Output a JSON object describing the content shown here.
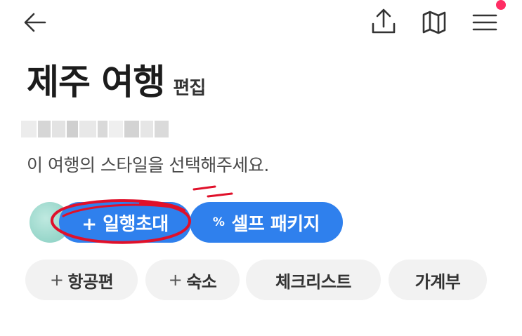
{
  "header": {
    "back_icon": "arrow-left-icon",
    "share_icon": "upload-share-icon",
    "map_icon": "map-icon",
    "menu_icon": "hamburger-menu-icon",
    "notification_dot_color": "#ff2d64"
  },
  "trip": {
    "title": "제주 여행",
    "edit_label": "편집",
    "subtitle": "이 여행의 스타일을 선택해주세요."
  },
  "actions": {
    "invite_label": "+ 일행초대",
    "self_pct": "%",
    "self_label": "셀프 패키지",
    "accent_color": "#2f80ed"
  },
  "chips": {
    "flight_plus": "+",
    "flight_label": "항공편",
    "stay_plus": "+",
    "stay_label": "숙소",
    "checklist_label": "체크리스트",
    "budget_label": "가계부"
  },
  "annotation": {
    "color": "#e0102a"
  }
}
